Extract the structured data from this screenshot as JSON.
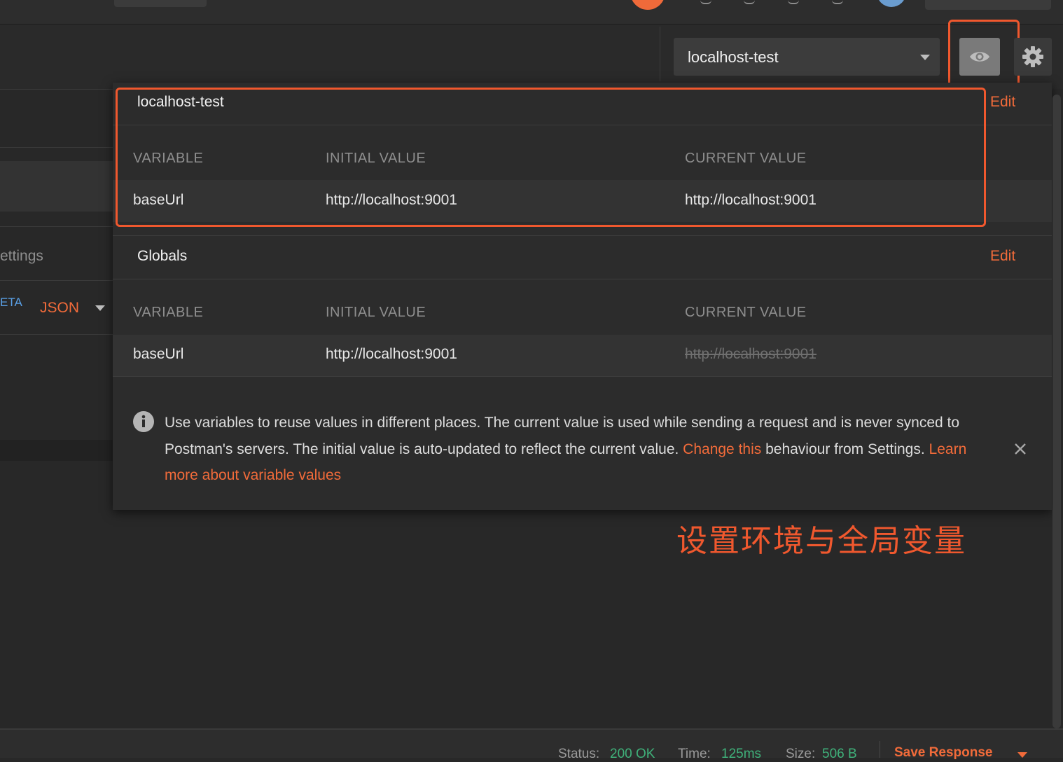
{
  "environment": {
    "selected": "localhost-test"
  },
  "left_panel": {
    "settings_fragment": "ettings",
    "beta_fragment": "ETA",
    "format_select": "JSON"
  },
  "env_section": {
    "title": "localhost-test",
    "edit_label": "Edit",
    "columns": [
      "VARIABLE",
      "INITIAL VALUE",
      "CURRENT VALUE"
    ],
    "rows": [
      {
        "variable": "baseUrl",
        "initial": "http://localhost:9001",
        "current": "http://localhost:9001"
      }
    ]
  },
  "globals_section": {
    "title": "Globals",
    "edit_label": "Edit",
    "columns": [
      "VARIABLE",
      "INITIAL VALUE",
      "CURRENT VALUE"
    ],
    "rows": [
      {
        "variable": "baseUrl",
        "initial": "http://localhost:9001",
        "current": "http://localhost:9001"
      }
    ]
  },
  "info": {
    "text1": "Use variables to reuse values in different places. The current value is used while sending a request and is never synced to Postman's servers. The initial value is auto-updated to reflect the current value. ",
    "link1": "Change this",
    "text2": " behaviour from Settings. ",
    "link2": "Learn more about variable values"
  },
  "caption": "设置环境与全局变量",
  "status_bar": {
    "status_label": "Status:",
    "status_value": "200 OK",
    "time_label": "Time:",
    "time_value": "125ms",
    "size_label": "Size:",
    "size_value": "506 B",
    "save_label": "Save Response"
  },
  "colors": {
    "accent": "#f26b3a",
    "highlight": "#f0582e",
    "success": "#3fb17a"
  },
  "icons": [
    "eye-icon",
    "gear-icon",
    "info-icon",
    "close-icon",
    "chevron-down-icon"
  ]
}
